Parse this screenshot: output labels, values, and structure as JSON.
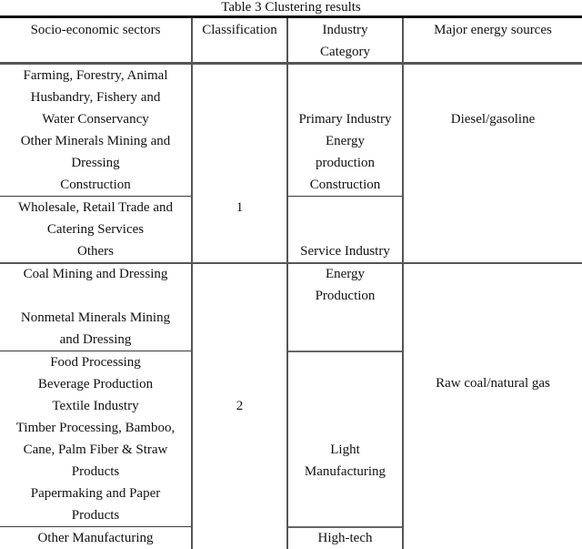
{
  "title": "Table 3 Clustering results",
  "headers": {
    "sectors": "Socio-economic sectors",
    "classification": "Classification",
    "industry_line1": "Industry",
    "industry_line2": "Category",
    "energy": "Major energy sources"
  },
  "groups": [
    {
      "classification": "1",
      "energy_source": "Diesel/gasoline",
      "blocks": [
        {
          "sectors": [
            "Farming, Forestry, Animal",
            "Husbandry, Fishery and",
            "Water Conservancy",
            "Other Minerals Mining and",
            "Dressing",
            "Construction"
          ],
          "industry": [
            "Primary Industry",
            "Energy",
            "production",
            "Construction"
          ]
        },
        {
          "sectors": [
            "Wholesale, Retail Trade and",
            "Catering Services",
            "Others"
          ],
          "industry": [
            "Service Industry"
          ]
        }
      ]
    },
    {
      "classification": "2",
      "energy_source": "Raw coal/natural gas",
      "blocks": [
        {
          "sectors": [
            "Coal Mining and Dressing",
            "",
            "Nonmetal Minerals Mining",
            "and Dressing"
          ],
          "industry": [
            "Energy",
            "Production"
          ]
        },
        {
          "sectors": [
            "Food Processing",
            "Beverage Production",
            "Textile Industry",
            "Timber Processing, Bamboo,",
            "Cane, Palm Fiber & Straw",
            "Products",
            "Papermaking and Paper",
            "Products"
          ],
          "industry": [
            "Light",
            "Manufacturing"
          ]
        },
        {
          "sectors": [
            "Other Manufacturing"
          ],
          "industry": [
            "High-tech"
          ]
        }
      ]
    }
  ]
}
